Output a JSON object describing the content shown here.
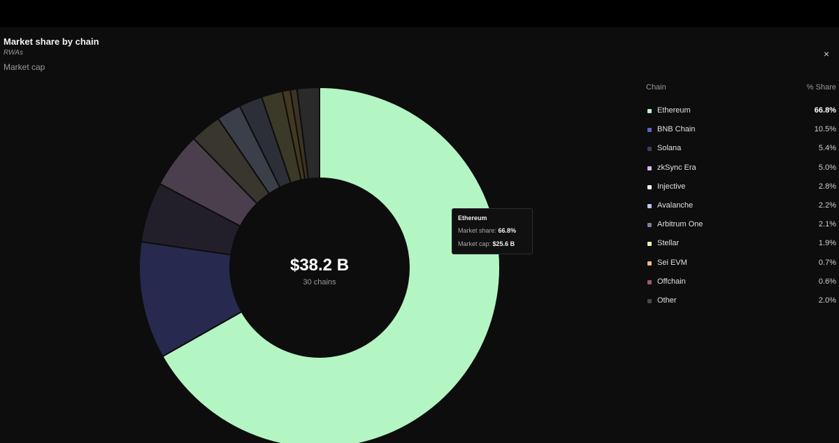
{
  "header": {
    "title": "Market share by chain",
    "subtitle": "RWAs",
    "metric": "Market cap",
    "close_symbol": "×"
  },
  "center": {
    "value": "$38.2 B",
    "label": "30 chains"
  },
  "tooltip": {
    "title": "Ethereum",
    "share_label": "Market share:",
    "share_value": "66.8%",
    "cap_label": "Market cap:",
    "cap_value": "$25.6 B"
  },
  "legend": {
    "col1": "Chain",
    "col2": "% Share"
  },
  "chart_data": {
    "type": "pie",
    "style": "donut",
    "categories": [
      "Ethereum",
      "BNB Chain",
      "Solana",
      "zkSync Era",
      "Injective",
      "Avalanche",
      "Arbitrum One",
      "Stellar",
      "Sei EVM",
      "Offchain",
      "Other"
    ],
    "values": [
      66.8,
      10.5,
      5.4,
      5.0,
      2.8,
      2.2,
      2.1,
      1.9,
      0.7,
      0.6,
      2.0
    ],
    "labels": [
      "66.8%",
      "10.5%",
      "5.4%",
      "5.0%",
      "2.8%",
      "2.2%",
      "2.1%",
      "1.9%",
      "0.7%",
      "0.6%",
      "2.0%"
    ],
    "legend_colors": [
      "#b5f5c6",
      "#5d62c9",
      "#3a3f5e",
      "#d5b8f0",
      "#f5f5f5",
      "#b8c4f5",
      "#7a7f9a",
      "#f2f0b0",
      "#e8c07a",
      "#9c5878",
      "#4a4a4a"
    ],
    "slice_colors": [
      "#b4f5c4",
      "#272a4e",
      "#221f2a",
      "#4b3f4e",
      "#39362e",
      "#3a3f4a",
      "#2c2f38",
      "#3b3a28",
      "#43391f",
      "#3b3424",
      "#2a2a2a"
    ]
  }
}
